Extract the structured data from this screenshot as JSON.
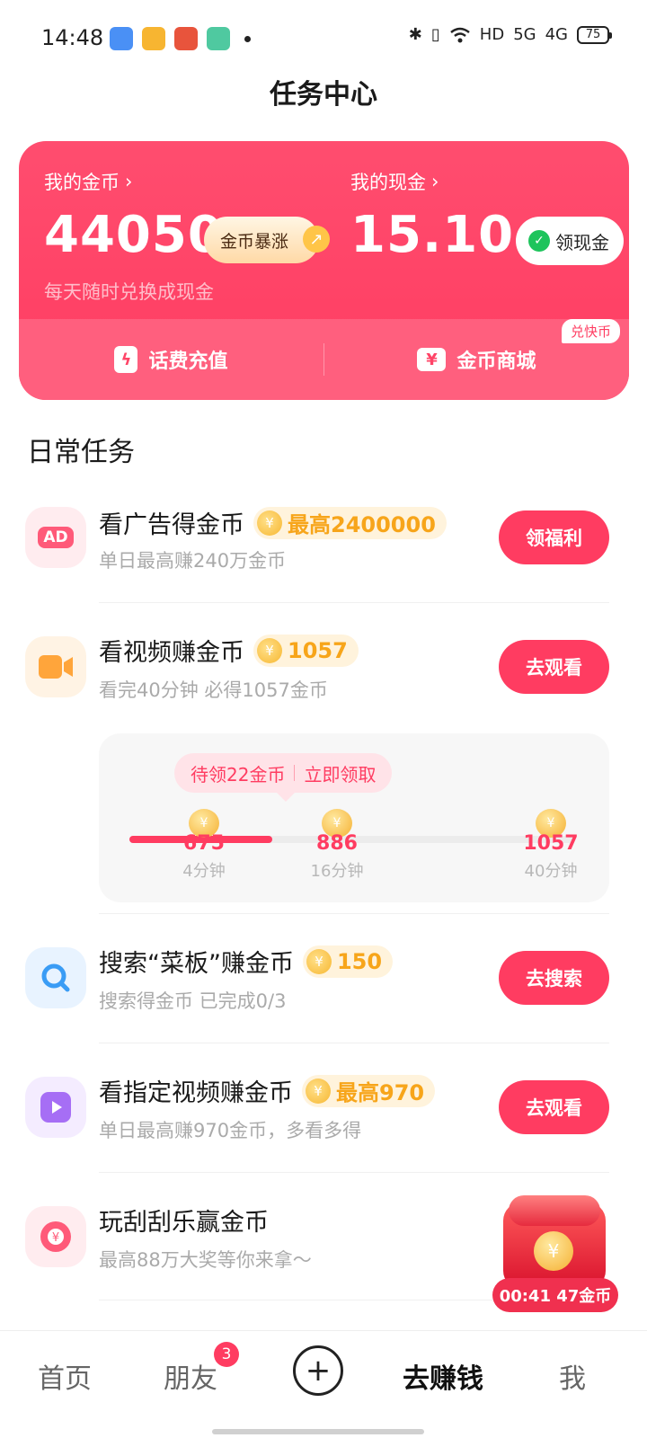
{
  "status_bar": {
    "time": "14:48",
    "hd": "HD",
    "signal_5g": "5G",
    "signal_4g": "4G",
    "battery": "75"
  },
  "page": {
    "title": "任务中心"
  },
  "coin_card": {
    "coins_label": "我的金币",
    "coins_value": "44050",
    "boom_label": "金币暴涨",
    "cash_label": "我的现金",
    "cash_value": "15.10",
    "claim_cash_label": "领现金",
    "subtitle": "每天随时兑换成现金",
    "recharge_label": "话费充值",
    "mall_label": "金币商城",
    "mall_badge": "兑快币"
  },
  "section": {
    "title": "日常任务"
  },
  "tasks": [
    {
      "title": "看广告得金币",
      "reward": "最高2400000",
      "sub": "单日最高赚240万金币",
      "button": "领福利",
      "icon": "ad-icon"
    },
    {
      "title": "看视频赚金币",
      "reward": "1057",
      "sub": "看完40分钟 必得1057金币",
      "button": "去观看",
      "icon": "video-camera-icon"
    },
    {
      "title": "搜索“菜板”赚金币",
      "reward": "150",
      "sub": "搜索得金币 已完成0/3",
      "button": "去搜索",
      "icon": "search-icon"
    },
    {
      "title": "看指定视频赚金币",
      "reward": "最高970",
      "sub": "单日最高赚970金币，多看多得",
      "button": "去观看",
      "icon": "play-icon"
    },
    {
      "title": "玩刮刮乐赢金币",
      "sub": "最高88万大奖等你来拿～",
      "icon": "scratch-card-icon"
    }
  ],
  "video_progress": {
    "tip_pending": "待领22金币",
    "tip_action": "立即领取",
    "filled_fraction": 0.32,
    "milestones": [
      {
        "amount": "675",
        "time": "4分钟"
      },
      {
        "amount": "886",
        "time": "16分钟"
      },
      {
        "amount": "1057",
        "time": "40分钟"
      }
    ]
  },
  "chest": {
    "label": "00:41 47金币"
  },
  "bottom_nav": {
    "home": "首页",
    "friends": "朋友",
    "friends_badge": "3",
    "plus": "+",
    "earn": "去赚钱",
    "me": "我"
  },
  "colors": {
    "accent": "#ff3c61",
    "coin": "#f7a51a"
  }
}
